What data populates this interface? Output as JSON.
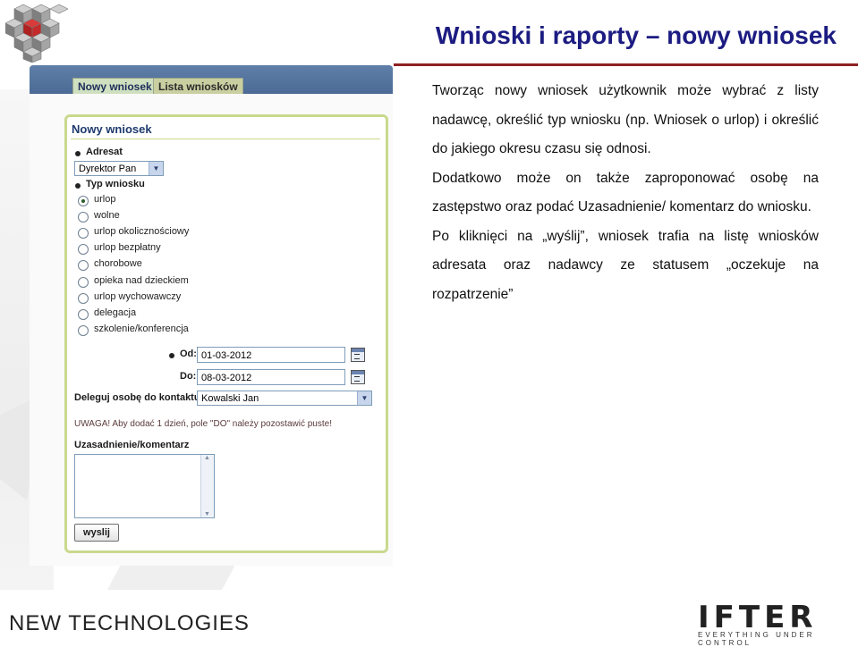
{
  "slide": {
    "title": "Wnioski i raporty – nowy wniosek",
    "footer_left": "NEW TECHNOLOGIES",
    "footer_right_logo": "IFTER",
    "footer_right_tagline": "EVERYTHING UNDER CONTROL"
  },
  "tabs": [
    {
      "label": "Nowy wniosek",
      "active": true
    },
    {
      "label": "Lista wniosków",
      "active": false
    }
  ],
  "form": {
    "heading": "Nowy wniosek",
    "addressee_label": "Adresat",
    "addressee_value": "Dyrektor Pan",
    "type_label": "Typ wniosku",
    "types": [
      "urlop",
      "wolne",
      "urlop okolicznościowy",
      "urlop bezpłatny",
      "chorobowe",
      "opieka nad dzieckiem",
      "urlop wychowawczy",
      "delegacja",
      "szkolenie/konferencja"
    ],
    "selected_type": "urlop",
    "from_label": "Od:",
    "from_value": "01-03-2012",
    "to_label": "Do:",
    "to_value": "08-03-2012",
    "delegate_label": "Deleguj osobę do kontaktu",
    "delegate_value": "Kowalski Jan",
    "warning": "UWAGA! Aby dodać 1 dzień, pole \"DO\" należy pozostawić puste!",
    "comment_label": "Uzasadnienie/komentarz",
    "comment_value": "",
    "send_label": "wyslij"
  },
  "description": {
    "p1": "Tworząc nowy wniosek użytkownik może wybrać z listy nadawcę, określić typ wniosku (np. Wniosek o urlop) i określić do jakiego okresu czasu się odnosi.",
    "p2": "Dodatkowo może on także zaproponować osobę na zastępstwo oraz podać Uzasadnienie/ komentarz do wniosku.",
    "p3": "Po kliknięci na „wyślij”, wniosek trafia na listę wniosków adresata oraz nadawcy ze statusem „oczekuje na rozpatrzenie”"
  },
  "colors": {
    "title": "#1c1c82",
    "accent_line": "#8f2121",
    "panel_border": "#c9d98e",
    "top_band": "#4b6a95"
  },
  "icons": [
    "dropdown-arrow-icon",
    "calendar-icon",
    "bullet-icon"
  ]
}
